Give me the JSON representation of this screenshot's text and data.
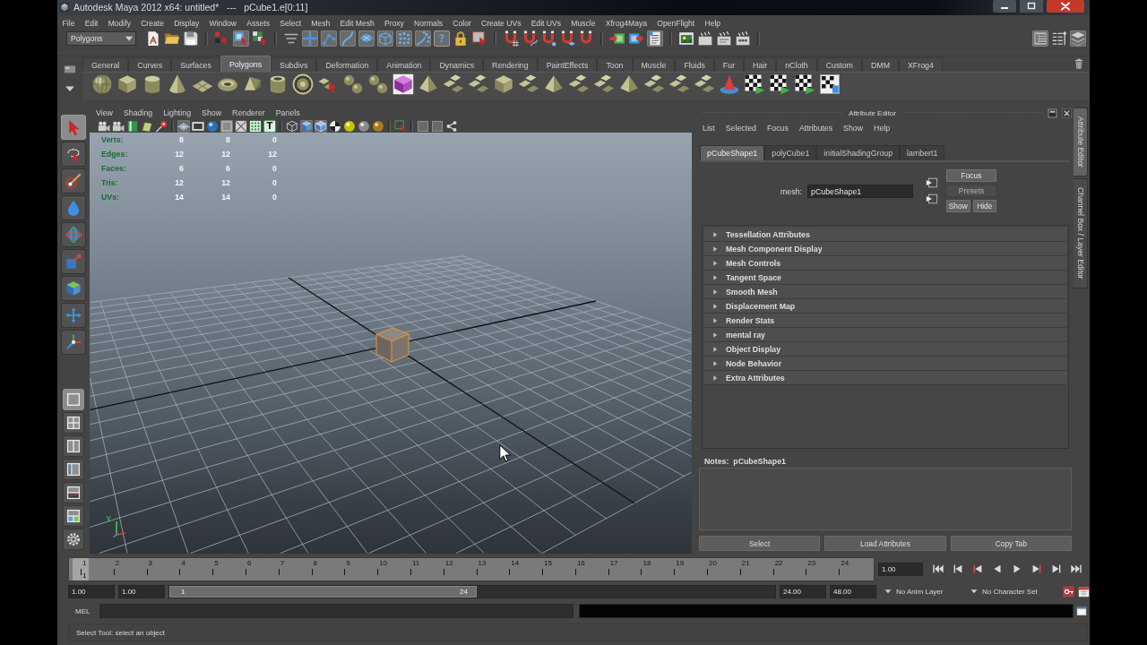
{
  "window": {
    "title": "Autodesk Maya 2012 x64: untitled*   ---   pCube1.e[0:11]"
  },
  "menu_bar": [
    "File",
    "Edit",
    "Modify",
    "Create",
    "Display",
    "Window",
    "Assets",
    "Select",
    "Mesh",
    "Edit Mesh",
    "Proxy",
    "Normals",
    "Color",
    "Create UVs",
    "Edit UVs",
    "Muscle",
    "Xfrog4Maya",
    "OpenFlight",
    "Help"
  ],
  "status_line": {
    "menu_set": "Polygons",
    "groups": [
      [
        {
          "kind": "page",
          "selected": false
        },
        {
          "kind": "folder",
          "selected": false
        },
        {
          "kind": "disk",
          "selected": false
        }
      ],
      [
        {
          "kind": "hierarchy",
          "selected": false
        },
        {
          "kind": "objecttype",
          "selected": true
        },
        {
          "kind": "component",
          "selected": false
        }
      ],
      [
        {
          "kind": "maskmenu",
          "selected": false
        },
        {
          "kind": "handles",
          "selected": true
        },
        {
          "kind": "joints",
          "selected": true
        },
        {
          "kind": "curves",
          "selected": true
        },
        {
          "kind": "surfaces",
          "selected": true
        },
        {
          "kind": "deformers",
          "selected": true
        },
        {
          "kind": "dynamics",
          "selected": true
        },
        {
          "kind": "particles",
          "selected": true
        },
        {
          "kind": "helpglyph",
          "label": "?",
          "selected": true
        },
        {
          "kind": "lock",
          "selected": false
        },
        {
          "kind": "highlight",
          "selected": false
        }
      ],
      [
        {
          "kind": "snapgrid",
          "selected": false
        },
        {
          "kind": "snapcurve",
          "selected": false
        },
        {
          "kind": "snappoint",
          "selected": false
        },
        {
          "kind": "snapplane",
          "selected": false
        },
        {
          "kind": "snaplive",
          "selected": false
        }
      ],
      [
        {
          "kind": "inputs",
          "selected": false
        },
        {
          "kind": "outputs",
          "selected": false
        },
        {
          "kind": "history",
          "selected": true
        }
      ],
      [
        {
          "kind": "renderview",
          "selected": false
        },
        {
          "kind": "clapper",
          "selected": false
        },
        {
          "kind": "iprclapper",
          "selected": false
        },
        {
          "kind": "dotclapper",
          "selected": false
        }
      ]
    ],
    "panels": [
      {
        "kind": "attrpanel",
        "selected": true
      },
      {
        "kind": "toolpanel",
        "selected": false
      },
      {
        "kind": "layerpanel",
        "selected": true
      }
    ]
  },
  "shelf": {
    "tabs": [
      {
        "label": "General",
        "selected": false
      },
      {
        "label": "Curves",
        "selected": false
      },
      {
        "label": "Surfaces",
        "selected": false
      },
      {
        "label": "Polygons",
        "selected": true
      },
      {
        "label": "Subdivs",
        "selected": false
      },
      {
        "label": "Deformation",
        "selected": false
      },
      {
        "label": "Animation",
        "selected": false
      },
      {
        "label": "Dynamics",
        "selected": false
      },
      {
        "label": "Rendering",
        "selected": false
      },
      {
        "label": "PaintEffects",
        "selected": false
      },
      {
        "label": "Toon",
        "selected": false
      },
      {
        "label": "Muscle",
        "selected": false
      },
      {
        "label": "Fluids",
        "selected": false
      },
      {
        "label": "Fur",
        "selected": false
      },
      {
        "label": "Hair",
        "selected": false
      },
      {
        "label": "nCloth",
        "selected": false
      },
      {
        "label": "Custom",
        "selected": false
      },
      {
        "label": "DMM",
        "selected": false
      },
      {
        "label": "XFrog4",
        "selected": false
      }
    ],
    "items": [
      {
        "kind": "sphere"
      },
      {
        "kind": "cube"
      },
      {
        "kind": "cylinder"
      },
      {
        "kind": "cone"
      },
      {
        "kind": "plane"
      },
      {
        "kind": "torus"
      },
      {
        "kind": "prism"
      },
      {
        "kind": "pipe"
      },
      {
        "kind": "ring"
      },
      {
        "kind": "combine"
      },
      {
        "kind": "separate"
      },
      {
        "kind": "separate"
      },
      {
        "kind": "purplecube"
      },
      {
        "kind": "pyramid"
      },
      {
        "kind": "tiles"
      },
      {
        "kind": "tiles"
      },
      {
        "kind": "cube"
      },
      {
        "kind": "tiles"
      },
      {
        "kind": "pyramid"
      },
      {
        "kind": "tiles"
      },
      {
        "kind": "tiles"
      },
      {
        "kind": "pyramid"
      },
      {
        "kind": "tiles"
      },
      {
        "kind": "tiles"
      },
      {
        "kind": "tiles"
      },
      {
        "kind": "redcone"
      },
      {
        "kind": "checker"
      },
      {
        "kind": "checker"
      },
      {
        "kind": "checker"
      },
      {
        "kind": "checkerpage"
      }
    ]
  },
  "toolbox": [
    [
      {
        "kind": "select",
        "selected": true
      },
      {
        "kind": "lasso",
        "selected": false
      },
      {
        "kind": "paint",
        "selected": false
      },
      {
        "kind": "softmod",
        "selected": false
      },
      {
        "kind": "rotate",
        "selected": false
      },
      {
        "kind": "scale",
        "selected": false
      },
      {
        "kind": "manip",
        "selected": false
      },
      {
        "kind": "move",
        "selected": false
      },
      {
        "kind": "showmanip",
        "selected": false
      }
    ],
    [
      {
        "kind": "singlepane",
        "selected": true
      },
      {
        "kind": "quadpane",
        "selected": false
      },
      {
        "kind": "splitpane",
        "selected": false
      },
      {
        "kind": "outlinerpane",
        "selected": false
      },
      {
        "kind": "graphpane",
        "selected": false
      },
      {
        "kind": "hypershadepane",
        "selected": false
      }
    ],
    [
      {
        "kind": "lastused",
        "selected": false
      }
    ]
  ],
  "viewport": {
    "menu": [
      "View",
      "Shading",
      "Lighting",
      "Show",
      "Renderer",
      "Panels"
    ],
    "toolbar": [
      [
        {
          "kind": "camera",
          "selected": false
        },
        {
          "kind": "camera",
          "selected": false
        },
        {
          "kind": "bookmark",
          "selected": false
        },
        {
          "kind": "imageplane",
          "selected": false
        },
        {
          "kind": "pin",
          "selected": false
        }
      ],
      [
        {
          "kind": "wiregrid",
          "selected": true
        },
        {
          "kind": "filmstrip",
          "selected": false
        },
        {
          "kind": "ball",
          "selected": false
        },
        {
          "kind": "greybox",
          "selected": true
        },
        {
          "kind": "crossbox",
          "selected": false
        },
        {
          "kind": "greendots",
          "selected": false
        },
        {
          "kind": "letterglyph",
          "label": "T",
          "selected": false
        }
      ],
      [
        {
          "kind": "wirecube",
          "selected": false
        },
        {
          "kind": "shadedcube",
          "selected": true
        },
        {
          "kind": "wireshaded",
          "selected": true
        },
        {
          "kind": "checkerball",
          "selected": false
        },
        {
          "kind": "lightball",
          "selected": false
        },
        {
          "kind": "greyball",
          "selected": false
        },
        {
          "kind": "goldball",
          "selected": false
        }
      ],
      [
        {
          "kind": "selectbox",
          "selected": false
        }
      ],
      [
        {
          "kind": "panelbox",
          "selected": false
        },
        {
          "kind": "panelbox",
          "selected": false
        },
        {
          "kind": "share",
          "selected": false
        }
      ]
    ],
    "hud": [
      {
        "label": "Verts:",
        "values": [
          "8",
          "8",
          "0"
        ]
      },
      {
        "label": "Edges:",
        "values": [
          "12",
          "12",
          "12"
        ]
      },
      {
        "label": "Faces:",
        "values": [
          "6",
          "6",
          "0"
        ]
      },
      {
        "label": "Tris:",
        "values": [
          "12",
          "12",
          "0"
        ]
      },
      {
        "label": "UVs:",
        "values": [
          "14",
          "14",
          "0"
        ]
      }
    ],
    "axis_label": "y"
  },
  "attribute_editor": {
    "title": "Attribute Editor",
    "menu": [
      "List",
      "Selected",
      "Focus",
      "Attributes",
      "Show",
      "Help"
    ],
    "tabs": [
      {
        "label": "pCubeShape1",
        "selected": true
      },
      {
        "label": "polyCube1",
        "selected": false
      },
      {
        "label": "initialShadingGroup",
        "selected": false
      },
      {
        "label": "lambert1",
        "selected": false
      }
    ],
    "node_type": "mesh:",
    "node_name": "pCubeShape1",
    "buttons": [
      {
        "label": "Focus",
        "disabled": false
      },
      {
        "label": "Presets",
        "disabled": true
      },
      {
        "label": "Show",
        "disabled": false
      },
      {
        "label": "Hide",
        "disabled": false
      }
    ],
    "sections": [
      {
        "label": "Tessellation Attributes",
        "expanded": false
      },
      {
        "label": "Mesh Component Display",
        "expanded": false
      },
      {
        "label": "Mesh Controls",
        "expanded": false
      },
      {
        "label": "Tangent Space",
        "expanded": false
      },
      {
        "label": "Smooth Mesh",
        "expanded": false
      },
      {
        "label": "Displacement Map",
        "expanded": false
      },
      {
        "label": "Render Stats",
        "expanded": false
      },
      {
        "label": "mental ray",
        "expanded": false
      },
      {
        "label": "Object Display",
        "expanded": false
      },
      {
        "label": "Node Behavior",
        "expanded": false
      },
      {
        "label": "Extra Attributes",
        "expanded": false
      }
    ],
    "notes_label": "Notes:  pCubeShape1",
    "footer_buttons": [
      "Select",
      "Load Attributes",
      "Copy Tab"
    ]
  },
  "side_tabs": [
    {
      "label": "Attribute Editor",
      "selected": true
    },
    {
      "label": "Channel Box / Layer Editor",
      "selected": false
    }
  ],
  "time_slider": {
    "frames": [
      {
        "label": "1",
        "selected": true
      },
      {
        "label": "2",
        "selected": false
      },
      {
        "label": "3",
        "selected": false
      },
      {
        "label": "4",
        "selected": false
      },
      {
        "label": "5",
        "selected": false
      },
      {
        "label": "6",
        "selected": false
      },
      {
        "label": "7",
        "selected": false
      },
      {
        "label": "8",
        "selected": false
      },
      {
        "label": "9",
        "selected": false
      },
      {
        "label": "10",
        "selected": false
      },
      {
        "label": "11",
        "selected": false
      },
      {
        "label": "12",
        "selected": false
      },
      {
        "label": "13",
        "selected": false
      },
      {
        "label": "14",
        "selected": false
      },
      {
        "label": "15",
        "selected": false
      },
      {
        "label": "16",
        "selected": false
      },
      {
        "label": "17",
        "selected": false
      },
      {
        "label": "18",
        "selected": false
      },
      {
        "label": "19",
        "selected": false
      },
      {
        "label": "20",
        "selected": false
      },
      {
        "label": "21",
        "selected": false
      },
      {
        "label": "22",
        "selected": false
      },
      {
        "label": "23",
        "selected": false
      },
      {
        "label": "24",
        "selected": false
      }
    ],
    "current_frame": "1",
    "current_time": "1.00"
  },
  "range_slider": {
    "start_time": "1.00",
    "playback_start": "1.00",
    "range_start": "1",
    "range_end": "24",
    "playback_end": "24.00",
    "end_time": "48.00",
    "anim_layer": "No Anim Layer",
    "character_set": "No Character Set"
  },
  "command_line": {
    "language": "MEL"
  },
  "help_line": "Select Tool: select an object"
}
